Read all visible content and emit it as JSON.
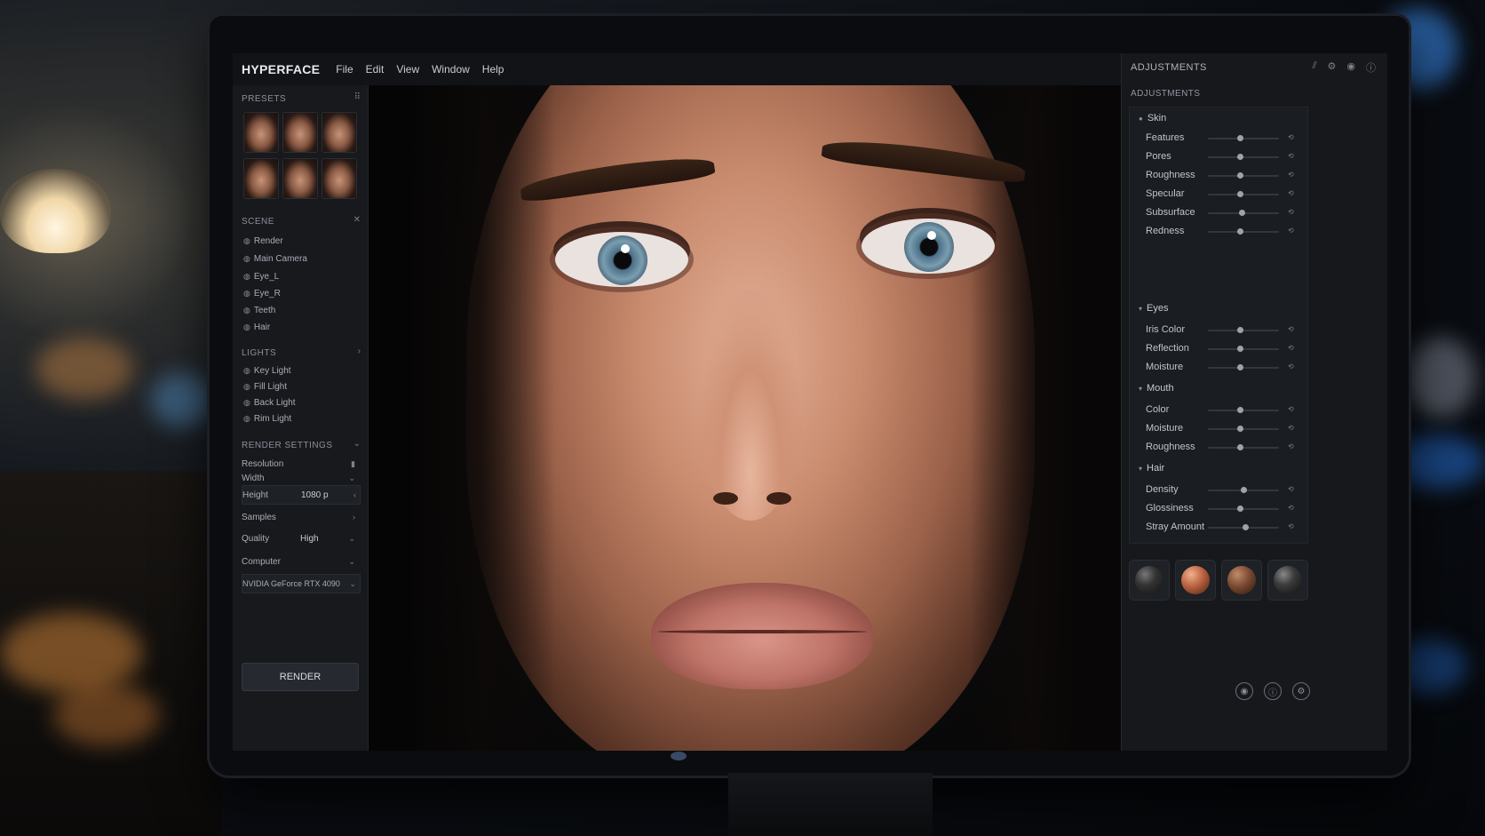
{
  "app": {
    "name": "HYPERFACE"
  },
  "menu": [
    "File",
    "Edit",
    "View",
    "Window",
    "Help"
  ],
  "left": {
    "presets_title": "PRESETS",
    "scene_title": "SCENE",
    "scene_items": [
      "Render",
      "Main Camera",
      "Eye_L",
      "Eye_R",
      "Teeth",
      "Hair"
    ],
    "lights_title": "LIGHTS",
    "lights_items": [
      "Key Light",
      "Fill Light",
      "Back Light",
      "Rim Light"
    ],
    "render_settings_title": "RENDER SETTINGS",
    "resolution_label": "Resolution",
    "width_label": "Width",
    "height_label": "Height",
    "height_value": "1080 p",
    "samples_label": "Samples",
    "quality_label": "Quality",
    "quality_value": "High",
    "computer_label": "Computer",
    "gpu_value": "NVIDIA GeForce RTX 4090",
    "render_button": "RENDER"
  },
  "right": {
    "header": "ADJUSTMENTS",
    "sub_header": "ADJUSTMENTS",
    "groups": {
      "skin": {
        "title": "Skin",
        "params": [
          {
            "label": "Features",
            "level": 0.45
          },
          {
            "label": "Pores",
            "level": 0.45
          },
          {
            "label": "Roughness",
            "level": 0.45
          },
          {
            "label": "Specular",
            "level": 0.45
          },
          {
            "label": "Subsurface",
            "level": 0.47
          },
          {
            "label": "Redness",
            "level": 0.45
          }
        ]
      },
      "eyes": {
        "title": "Eyes",
        "params": [
          {
            "label": "Iris Color",
            "level": 0.45
          },
          {
            "label": "Reflection",
            "level": 0.45
          },
          {
            "label": "Moisture",
            "level": 0.45
          }
        ]
      },
      "mouth": {
        "title": "Mouth",
        "params": [
          {
            "label": "Color",
            "level": 0.45
          },
          {
            "label": "Moisture",
            "level": 0.45
          },
          {
            "label": "Roughness",
            "level": 0.45
          }
        ]
      },
      "hair": {
        "title": "Hair",
        "params": [
          {
            "label": "Density",
            "level": 0.5
          },
          {
            "label": "Glossiness",
            "level": 0.45
          },
          {
            "label": "Stray Amount",
            "level": 0.52
          }
        ]
      }
    }
  },
  "colors": {
    "accent": "#9ea3ab",
    "panel": "#17191d",
    "skin": "#c98b6e",
    "iris": "#7a9db0"
  },
  "icons": [
    "minimize-icon",
    "pin-icon",
    "expand-icon",
    "info-icon",
    "close-icon",
    "camera-icon",
    "light-icon",
    "settings-icon"
  ]
}
